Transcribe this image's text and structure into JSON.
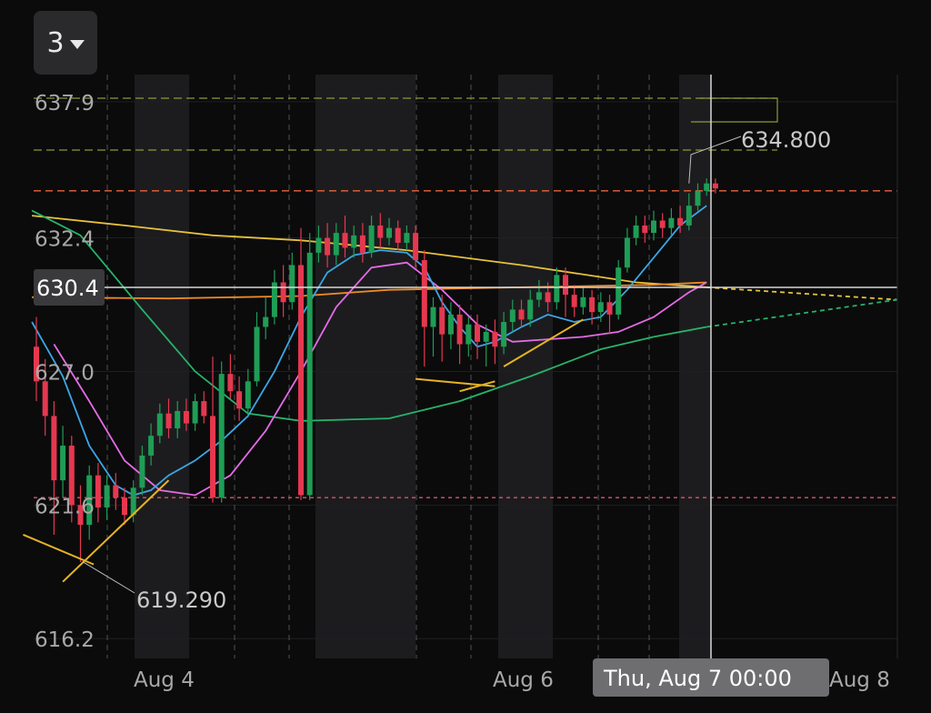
{
  "toolbar": {
    "timeframe": "3"
  },
  "chart_data": {
    "type": "candlestick",
    "ylim": [
      615.4,
      639.0
    ],
    "y_ticks": [
      "637.9",
      "632.4",
      "627.0",
      "621.6",
      "616.2"
    ],
    "x_ticks": [
      "Aug 4",
      "Aug 6",
      "Aug 8"
    ],
    "crosshair": {
      "price": "630.4",
      "time": "Thu, Aug 7 00:00"
    },
    "annotations": {
      "high": "634.800",
      "low": "619.290"
    },
    "levels": [
      {
        "name": "resistance",
        "value": 634.3,
        "color": "#e8643c",
        "style": "dashed"
      },
      {
        "name": "support",
        "value": 621.9,
        "color": "#e0506a",
        "style": "dotted"
      }
    ],
    "colors": {
      "up": "#1f9d55",
      "down": "#e5384f",
      "ma_fast": "#3ba7e6",
      "ma_mid": "#e66be6",
      "ma_green": "#27b36a",
      "ma_slow_orange": "#f08a24",
      "ma_slow_yellow": "#e6c23a",
      "trendline": "#e6b422"
    },
    "candles": [
      {
        "o": 628.0,
        "c": 626.6,
        "h": 629.2,
        "l": 625.8
      },
      {
        "o": 626.6,
        "c": 625.2,
        "h": 627.5,
        "l": 624.4
      },
      {
        "o": 625.2,
        "c": 622.6,
        "h": 625.8,
        "l": 620.4
      },
      {
        "o": 622.6,
        "c": 624.0,
        "h": 624.8,
        "l": 621.9
      },
      {
        "o": 624.0,
        "c": 621.6,
        "h": 624.4,
        "l": 620.9
      },
      {
        "o": 621.6,
        "c": 620.8,
        "h": 622.4,
        "l": 619.3
      },
      {
        "o": 620.8,
        "c": 622.8,
        "h": 623.2,
        "l": 620.2
      },
      {
        "o": 622.8,
        "c": 621.5,
        "h": 623.3,
        "l": 620.9
      },
      {
        "o": 621.5,
        "c": 622.4,
        "h": 622.8,
        "l": 621.0
      },
      {
        "o": 622.4,
        "c": 621.9,
        "h": 622.9,
        "l": 621.4
      },
      {
        "o": 621.9,
        "c": 621.2,
        "h": 622.3,
        "l": 620.8
      },
      {
        "o": 621.2,
        "c": 622.3,
        "h": 622.6,
        "l": 620.9
      },
      {
        "o": 622.3,
        "c": 623.6,
        "h": 624.0,
        "l": 622.0
      },
      {
        "o": 623.6,
        "c": 624.4,
        "h": 624.9,
        "l": 623.2
      },
      {
        "o": 624.4,
        "c": 625.3,
        "h": 625.7,
        "l": 624.1
      },
      {
        "o": 625.3,
        "c": 624.7,
        "h": 625.9,
        "l": 624.3
      },
      {
        "o": 624.7,
        "c": 625.4,
        "h": 625.8,
        "l": 624.3
      },
      {
        "o": 625.4,
        "c": 624.9,
        "h": 625.9,
        "l": 624.6
      },
      {
        "o": 624.9,
        "c": 625.8,
        "h": 626.1,
        "l": 624.6
      },
      {
        "o": 625.8,
        "c": 625.2,
        "h": 626.2,
        "l": 624.9
      },
      {
        "o": 625.2,
        "c": 621.9,
        "h": 627.6,
        "l": 621.7
      },
      {
        "o": 621.9,
        "c": 626.9,
        "h": 627.4,
        "l": 621.7
      },
      {
        "o": 626.9,
        "c": 626.2,
        "h": 627.7,
        "l": 625.9
      },
      {
        "o": 626.2,
        "c": 625.5,
        "h": 626.8,
        "l": 625.0
      },
      {
        "o": 625.5,
        "c": 626.6,
        "h": 627.1,
        "l": 625.2
      },
      {
        "o": 626.6,
        "c": 628.8,
        "h": 629.4,
        "l": 626.4
      },
      {
        "o": 628.8,
        "c": 629.2,
        "h": 630.0,
        "l": 628.3
      },
      {
        "o": 629.2,
        "c": 630.6,
        "h": 631.1,
        "l": 628.9
      },
      {
        "o": 630.6,
        "c": 629.8,
        "h": 631.3,
        "l": 629.2
      },
      {
        "o": 629.8,
        "c": 631.3,
        "h": 631.8,
        "l": 629.5
      },
      {
        "o": 631.3,
        "c": 622.0,
        "h": 632.8,
        "l": 621.8
      },
      {
        "o": 622.0,
        "c": 631.8,
        "h": 632.6,
        "l": 621.8
      },
      {
        "o": 631.8,
        "c": 632.4,
        "h": 632.9,
        "l": 631.4
      },
      {
        "o": 632.4,
        "c": 631.7,
        "h": 633.0,
        "l": 631.2
      },
      {
        "o": 631.7,
        "c": 632.6,
        "h": 633.0,
        "l": 631.3
      },
      {
        "o": 632.6,
        "c": 632.0,
        "h": 633.3,
        "l": 631.6
      },
      {
        "o": 632.0,
        "c": 632.5,
        "h": 632.9,
        "l": 631.6
      },
      {
        "o": 632.5,
        "c": 631.8,
        "h": 633.0,
        "l": 631.4
      },
      {
        "o": 631.8,
        "c": 632.9,
        "h": 633.3,
        "l": 631.6
      },
      {
        "o": 632.9,
        "c": 632.4,
        "h": 633.4,
        "l": 632.0
      },
      {
        "o": 632.4,
        "c": 632.8,
        "h": 633.2,
        "l": 632.1
      },
      {
        "o": 632.8,
        "c": 632.2,
        "h": 633.1,
        "l": 631.9
      },
      {
        "o": 632.2,
        "c": 632.6,
        "h": 632.9,
        "l": 631.9
      },
      {
        "o": 632.6,
        "c": 631.5,
        "h": 632.9,
        "l": 631.2
      },
      {
        "o": 631.5,
        "c": 628.8,
        "h": 631.9,
        "l": 627.2
      },
      {
        "o": 628.8,
        "c": 629.6,
        "h": 630.0,
        "l": 627.6
      },
      {
        "o": 629.6,
        "c": 628.5,
        "h": 630.1,
        "l": 627.4
      },
      {
        "o": 628.5,
        "c": 629.3,
        "h": 629.8,
        "l": 627.9
      },
      {
        "o": 629.3,
        "c": 628.1,
        "h": 629.7,
        "l": 627.3
      },
      {
        "o": 628.1,
        "c": 628.9,
        "h": 629.2,
        "l": 627.6
      },
      {
        "o": 628.9,
        "c": 628.2,
        "h": 629.3,
        "l": 627.5
      },
      {
        "o": 628.2,
        "c": 628.6,
        "h": 628.9,
        "l": 627.2
      },
      {
        "o": 628.6,
        "c": 628.0,
        "h": 629.1,
        "l": 627.3
      },
      {
        "o": 628.0,
        "c": 629.0,
        "h": 629.4,
        "l": 627.7
      },
      {
        "o": 629.0,
        "c": 629.5,
        "h": 629.9,
        "l": 628.6
      },
      {
        "o": 629.5,
        "c": 629.1,
        "h": 629.9,
        "l": 628.8
      },
      {
        "o": 629.1,
        "c": 629.9,
        "h": 630.3,
        "l": 628.8
      },
      {
        "o": 629.9,
        "c": 630.2,
        "h": 630.7,
        "l": 629.6
      },
      {
        "o": 630.2,
        "c": 629.8,
        "h": 630.6,
        "l": 629.4
      },
      {
        "o": 629.8,
        "c": 630.9,
        "h": 631.2,
        "l": 629.5
      },
      {
        "o": 630.9,
        "c": 630.1,
        "h": 631.2,
        "l": 629.2
      },
      {
        "o": 630.1,
        "c": 629.6,
        "h": 630.5,
        "l": 629.2
      },
      {
        "o": 629.6,
        "c": 630.0,
        "h": 630.4,
        "l": 629.3
      },
      {
        "o": 630.0,
        "c": 629.4,
        "h": 630.3,
        "l": 628.9
      },
      {
        "o": 629.4,
        "c": 629.8,
        "h": 630.2,
        "l": 629.0
      },
      {
        "o": 629.8,
        "c": 629.3,
        "h": 630.1,
        "l": 628.5
      },
      {
        "o": 629.3,
        "c": 631.2,
        "h": 631.5,
        "l": 629.1
      },
      {
        "o": 631.2,
        "c": 632.4,
        "h": 632.8,
        "l": 631.0
      },
      {
        "o": 632.4,
        "c": 632.9,
        "h": 633.3,
        "l": 632.1
      },
      {
        "o": 632.9,
        "c": 632.6,
        "h": 633.3,
        "l": 632.2
      },
      {
        "o": 632.6,
        "c": 633.1,
        "h": 633.5,
        "l": 632.3
      },
      {
        "o": 633.1,
        "c": 632.8,
        "h": 633.4,
        "l": 632.4
      },
      {
        "o": 632.8,
        "c": 633.2,
        "h": 633.6,
        "l": 632.5
      },
      {
        "o": 633.2,
        "c": 632.9,
        "h": 633.7,
        "l": 632.6
      },
      {
        "o": 632.9,
        "c": 633.7,
        "h": 634.2,
        "l": 632.7
      },
      {
        "o": 633.7,
        "c": 634.3,
        "h": 634.6,
        "l": 633.5
      },
      {
        "o": 634.3,
        "c": 634.6,
        "h": 634.8,
        "l": 634.1
      },
      {
        "o": 634.6,
        "c": 634.4,
        "h": 634.8,
        "l": 634.2
      }
    ]
  }
}
